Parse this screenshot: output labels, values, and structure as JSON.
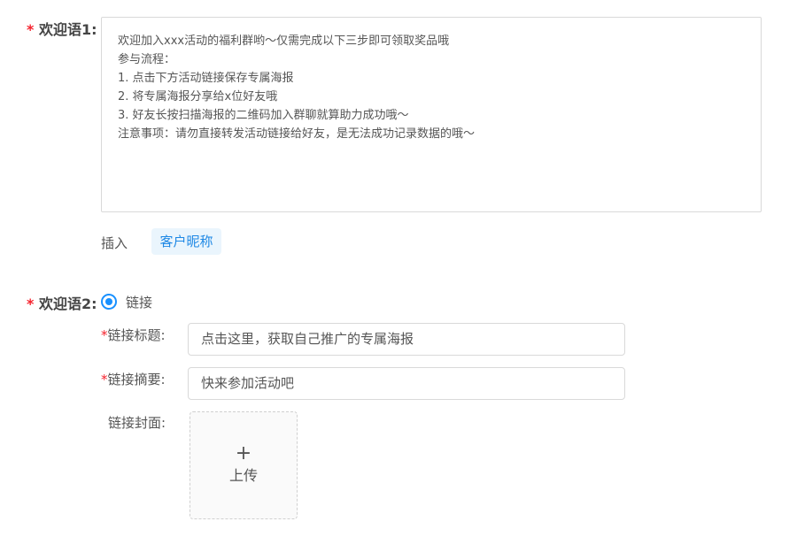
{
  "welcome1": {
    "required_mark": "*",
    "label": "欢迎语1:",
    "lines": [
      "欢迎加入xxx活动的福利群哟～仅需完成以下三步即可领取奖品哦",
      "参与流程：",
      "1. 点击下方活动链接保存专属海报",
      "2. 将专属海报分享给x位好友哦",
      "3. 好友长按扫描海报的二维码加入群聊就算助力成功哦～",
      "注意事项：请勿直接转发活动链接给好友，是无法成功记录数据的哦～"
    ],
    "insert_label": "插入",
    "nickname_button": "客户昵称"
  },
  "welcome2": {
    "required_mark": "*",
    "label": "欢迎语2:",
    "radio_label": "链接",
    "radio_checked": true,
    "link_title": {
      "required_mark": "*",
      "label": "链接标题:",
      "value": "点击这里，获取自己推广的专属海报"
    },
    "link_summary": {
      "required_mark": "*",
      "label": "链接摘要:",
      "value": "快来参加活动吧"
    },
    "link_cover": {
      "label": "链接封面:",
      "plus": "+",
      "upload_text": "上传"
    }
  },
  "colors": {
    "accent": "#1890ff",
    "required": "#f5222d",
    "tag_bg": "#eaf5fd"
  }
}
